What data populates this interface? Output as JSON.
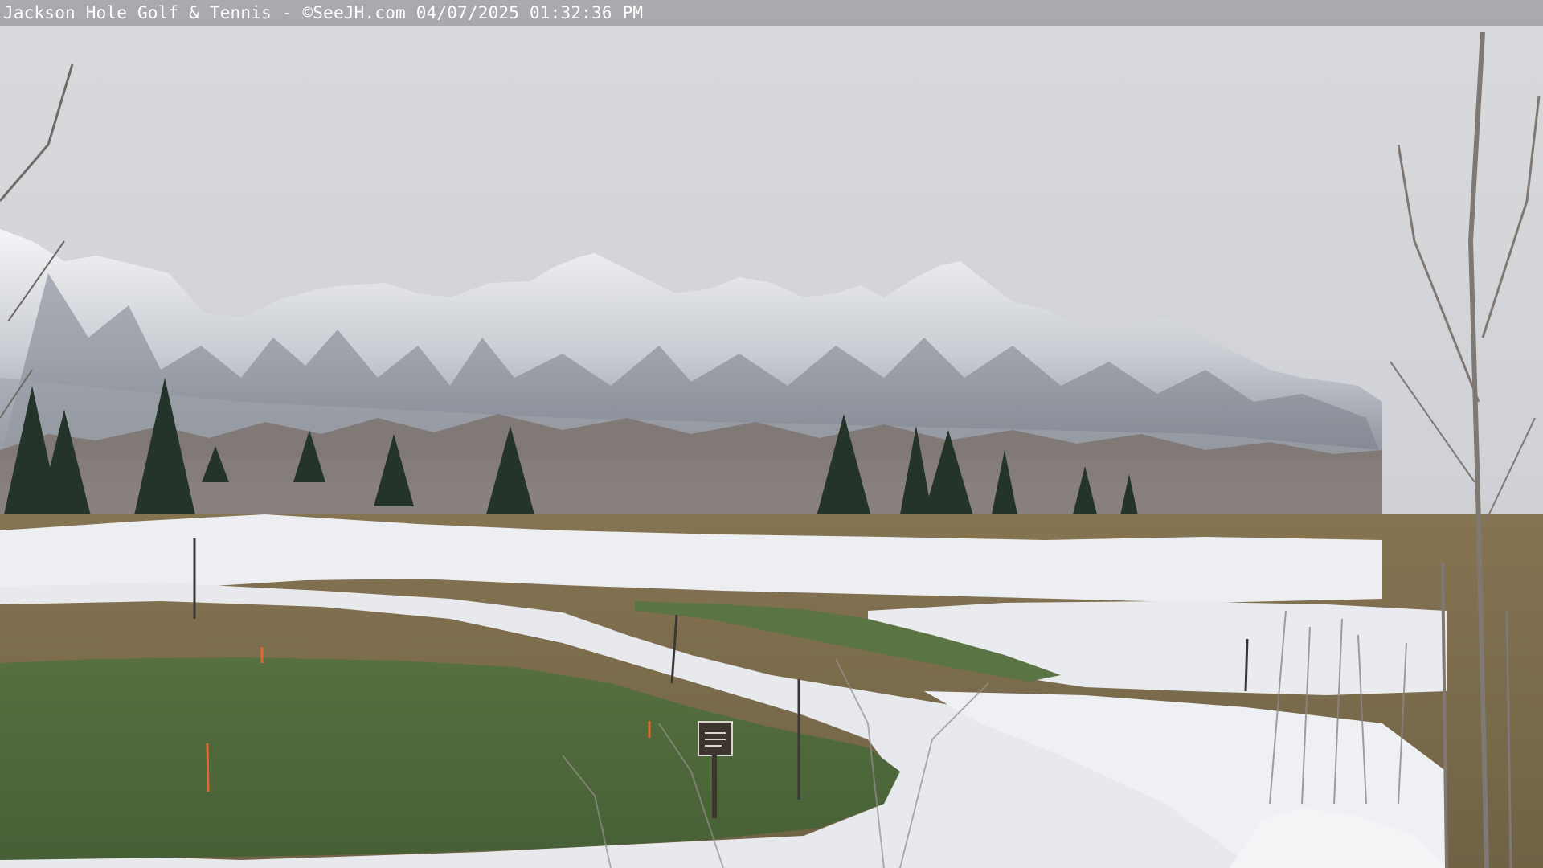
{
  "webcam": {
    "overlay_text": "Jackson Hole Golf & Tennis - ©SeeJH.com 04/07/2025 01:32:36 PM"
  },
  "scene": {
    "description_icon": "webcam-landscape-image",
    "colors": {
      "sky": "#d6d7db",
      "snow": "#eef0f3",
      "rock": "#6c7079",
      "fairway_green": "#4f6a3e",
      "dormant_grass": "#8a7a55",
      "conifer": "#26352a"
    }
  }
}
